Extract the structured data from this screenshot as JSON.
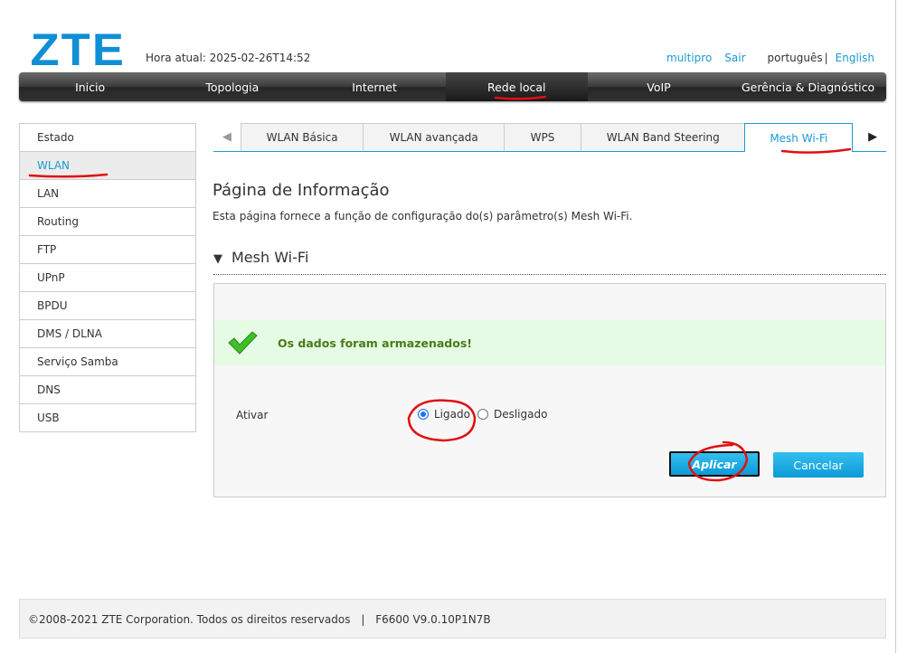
{
  "header": {
    "logo": "ZTE",
    "time_label": "Hora atual: 2025-02-26T14:52",
    "user": "multipro",
    "logout": "Sair",
    "lang_current": "português",
    "lang_sep": "|",
    "lang_other": "English"
  },
  "nav": [
    {
      "label": "Inicio"
    },
    {
      "label": "Topologia"
    },
    {
      "label": "Internet"
    },
    {
      "label": "Rede local",
      "active": true
    },
    {
      "label": "VoIP"
    },
    {
      "label": "Gerência & Diagnóstico"
    }
  ],
  "sidebar": [
    {
      "label": "Estado"
    },
    {
      "label": "WLAN",
      "active": true
    },
    {
      "label": "LAN"
    },
    {
      "label": "Routing"
    },
    {
      "label": "FTP"
    },
    {
      "label": "UPnP"
    },
    {
      "label": "BPDU"
    },
    {
      "label": "DMS / DLNA"
    },
    {
      "label": "Serviço Samba"
    },
    {
      "label": "DNS"
    },
    {
      "label": "USB"
    }
  ],
  "tabs": [
    {
      "label": "WLAN Básica"
    },
    {
      "label": "WLAN avançada"
    },
    {
      "label": "WPS"
    },
    {
      "label": "WLAN Band Steering"
    },
    {
      "label": "Mesh Wi-Fi",
      "active": true
    }
  ],
  "page": {
    "title": "Página de Informação",
    "description": "Esta página fornece a função de configuração do(s) parâmetro(s) Mesh Wi-Fi.",
    "section": "Mesh Wi-Fi",
    "section_toggle": "▼"
  },
  "form": {
    "success_msg": "Os dados foram armazenados!",
    "ativar_label": "Ativar",
    "on_label": "Ligado",
    "off_label": "Desligado",
    "selected": "Ligado",
    "apply": "Aplicar",
    "cancel": "Cancelar"
  },
  "footer": {
    "copyright": "©2008-2021 ZTE Corporation. Todos os direitos reservados",
    "sep": "|",
    "version": "F6600 V9.0.10P1N7B"
  },
  "colors": {
    "accent": "#1a9ad6",
    "success_bg": "#e6fbe3",
    "annotation": "#e01010"
  }
}
